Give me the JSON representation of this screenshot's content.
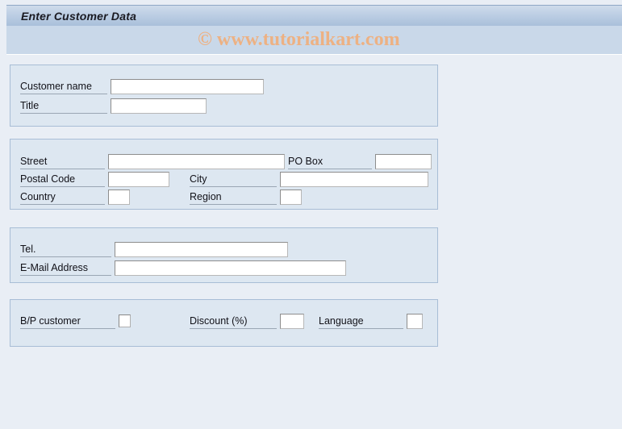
{
  "window": {
    "title": "Enter Customer Data",
    "watermark": "© www.tutorialkart.com"
  },
  "theme": {
    "page_background": "#e9eef5",
    "panel_background": "#dde7f1",
    "panel_border": "#a8bdd6",
    "titlebar_gradient_top": "#cfdceb",
    "titlebar_gradient_bottom": "#a9c0da",
    "subbar_background": "#c9d8e9",
    "watermark_color": "#edb183",
    "input_background": "#ffffff",
    "input_border": "#b7b7b7",
    "label_color": "#111118"
  },
  "groups": [
    {
      "name": "identity",
      "fields": [
        {
          "label": "Customer name",
          "value": "",
          "placeholder": "",
          "type": "text"
        },
        {
          "label": "Title",
          "value": "",
          "placeholder": "",
          "type": "text"
        }
      ]
    },
    {
      "name": "address",
      "fields": [
        {
          "label": "Street",
          "value": "",
          "placeholder": "",
          "type": "text"
        },
        {
          "label": "PO Box",
          "value": "",
          "placeholder": "",
          "type": "text"
        },
        {
          "label": "Postal Code",
          "value": "",
          "placeholder": "",
          "type": "text"
        },
        {
          "label": "City",
          "value": "",
          "placeholder": "",
          "type": "text"
        },
        {
          "label": "Country",
          "value": "",
          "placeholder": "",
          "type": "text"
        },
        {
          "label": "Region",
          "value": "",
          "placeholder": "",
          "type": "text"
        }
      ]
    },
    {
      "name": "contact",
      "fields": [
        {
          "label": "Tel.",
          "value": "",
          "placeholder": "",
          "type": "text"
        },
        {
          "label": "E-Mail Address",
          "value": "",
          "placeholder": "",
          "type": "text"
        }
      ]
    },
    {
      "name": "terms",
      "fields": [
        {
          "label": "B/P customer",
          "value": "",
          "placeholder": "",
          "type": "checkbox",
          "checked": false
        },
        {
          "label": "Discount (%)",
          "value": "",
          "placeholder": "",
          "type": "text"
        },
        {
          "label": "Language",
          "value": "",
          "placeholder": "",
          "type": "text"
        }
      ]
    }
  ]
}
